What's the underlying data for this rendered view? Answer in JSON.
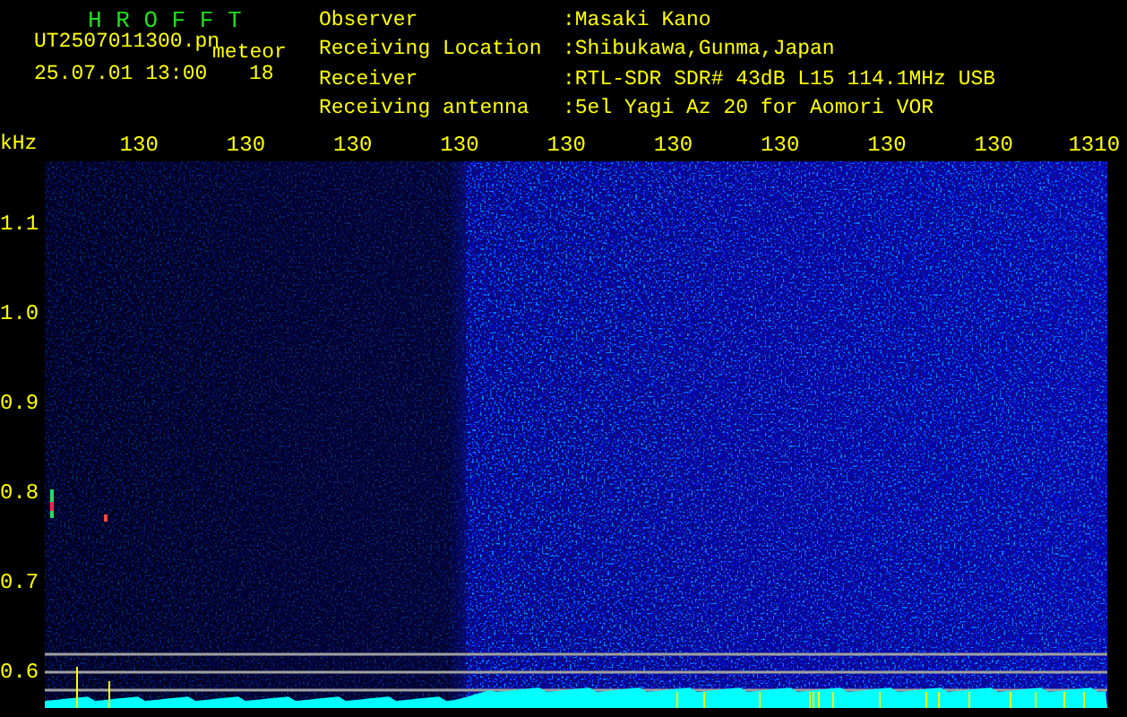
{
  "header": {
    "title": "H R O F F T",
    "filename": "UT2507011300.pn",
    "mode": "meteor",
    "datetime": "25.07.01 13:00",
    "count": "18"
  },
  "info": [
    {
      "label": "Observer",
      "value": ":Masaki Kano"
    },
    {
      "label": "Receiving Location",
      "value": ":Shibukawa,Gunma,Japan"
    },
    {
      "label": "Receiver",
      "value": ":RTL-SDR SDR# 43dB L15 114.1MHz USB"
    },
    {
      "label": "Receiving antenna",
      "value": ":5el Yagi Az 20 for Aomori VOR"
    }
  ],
  "x_axis": {
    "unit": "kHz",
    "ticks": [
      "130",
      "130",
      "130",
      "130",
      "130",
      "130",
      "130",
      "130",
      "130",
      "1310"
    ]
  },
  "y_axis": {
    "ticks": [
      "1.1",
      "1.0",
      "0.9",
      "0.8",
      "0.7",
      "0.6"
    ]
  }
}
